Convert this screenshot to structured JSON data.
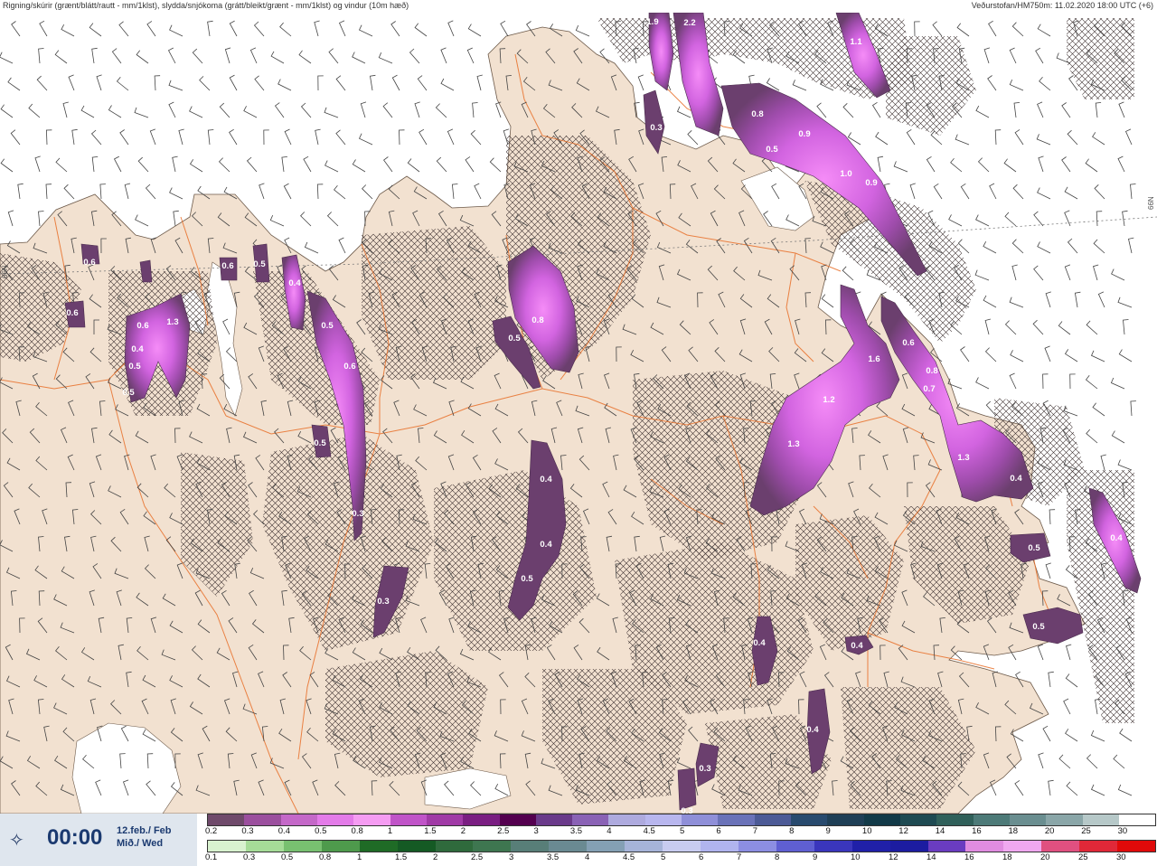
{
  "header": {
    "title": "Rigning/skúrir (grænt/blátt/rautt - mm/1klst), slydda/snjókoma (grátt/bleikt/grænt - mm/1klst) og vindur (10m hæð)",
    "source": "Veðurstofan/HM750m: 11.02.2020 18:00 UTC (+6)"
  },
  "map": {
    "region": "Northern Iceland",
    "latitude_label": "66N",
    "colors": {
      "sea": "#ffffff",
      "land": "#f2e1d0",
      "roads": "#e8702a",
      "hatch": "#3a2e2e",
      "precip_dark": "#6b3f6e",
      "precip_mid": "#9a4ba8",
      "precip_bright": "#e56ff0"
    },
    "precip_labels": [
      "1.9",
      "2.2",
      "1.1",
      "0.3",
      "0.8",
      "0.5",
      "0.9",
      "1.0",
      "0.9",
      "0.6",
      "0.6",
      "0.6",
      "0.4",
      "0.5",
      "0.5",
      "1.3",
      "0.6",
      "0.5",
      "0.4",
      "0.5",
      "0.6",
      "0.5",
      "0.3",
      "0.8",
      "0.5",
      "0.4",
      "0.4",
      "0.5",
      "0.3",
      "1.6",
      "1.2",
      "1.3",
      "0.6",
      "0.8",
      "0.7",
      "1.3",
      "0.4",
      "0.4",
      "0.5",
      "0.5",
      "0.4",
      "0.4",
      "0.4",
      "0.3",
      "0.3"
    ]
  },
  "time_panel": {
    "icon": "wind-compass-icon",
    "time": "00:00",
    "date_line1": "12.feb./ Feb",
    "date_line2": "Mið./ Wed"
  },
  "snow_scale": {
    "labels": [
      "0.2",
      "0.3",
      "0.4",
      "0.5",
      "0.8",
      "1",
      "1.5",
      "2",
      "2.5",
      "3",
      "3.5",
      "4",
      "4.5",
      "5",
      "6",
      "7",
      "8",
      "9",
      "10",
      "12",
      "14",
      "16",
      "18",
      "20",
      "25",
      "30"
    ],
    "colors": [
      "#6f4a6b",
      "#9b4f9e",
      "#c468c8",
      "#e37be8",
      "#f59cf2",
      "#c054c8",
      "#a03aa6",
      "#7a1e82",
      "#54004f",
      "#6a3a8a",
      "#8a62b5",
      "#aeaade",
      "#b8b6ee",
      "#8f8fd8",
      "#6a72b8",
      "#4c5a96",
      "#284a6e",
      "#1f3f56",
      "#123a48",
      "#1e4a52",
      "#30605a",
      "#4d7a78",
      "#6a8e90",
      "#8aa6a8",
      "#b6c8c8",
      "#ffffff"
    ]
  },
  "rain_scale": {
    "labels": [
      "0.1",
      "0.3",
      "0.5",
      "0.8",
      "1",
      "1.5",
      "2",
      "2.5",
      "3",
      "3.5",
      "4",
      "4.5",
      "5",
      "6",
      "7",
      "8",
      "9",
      "10",
      "12",
      "14",
      "16",
      "18",
      "20",
      "25",
      "30"
    ],
    "colors": [
      "#d8f2cf",
      "#a6dc98",
      "#78c070",
      "#4e9a4c",
      "#1f6b26",
      "#155a24",
      "#2f6a3c",
      "#3e7650",
      "#587e78",
      "#6a8a92",
      "#84a0b4",
      "#a6b4d8",
      "#c8ccf0",
      "#b0b4ee",
      "#8c8ee2",
      "#5f5fd2",
      "#3a36bc",
      "#2020a8",
      "#1c1ca0",
      "#6a3cc0",
      "#e08ce0",
      "#f0a8f0",
      "#e05080",
      "#e02838",
      "#e00a0a"
    ]
  }
}
